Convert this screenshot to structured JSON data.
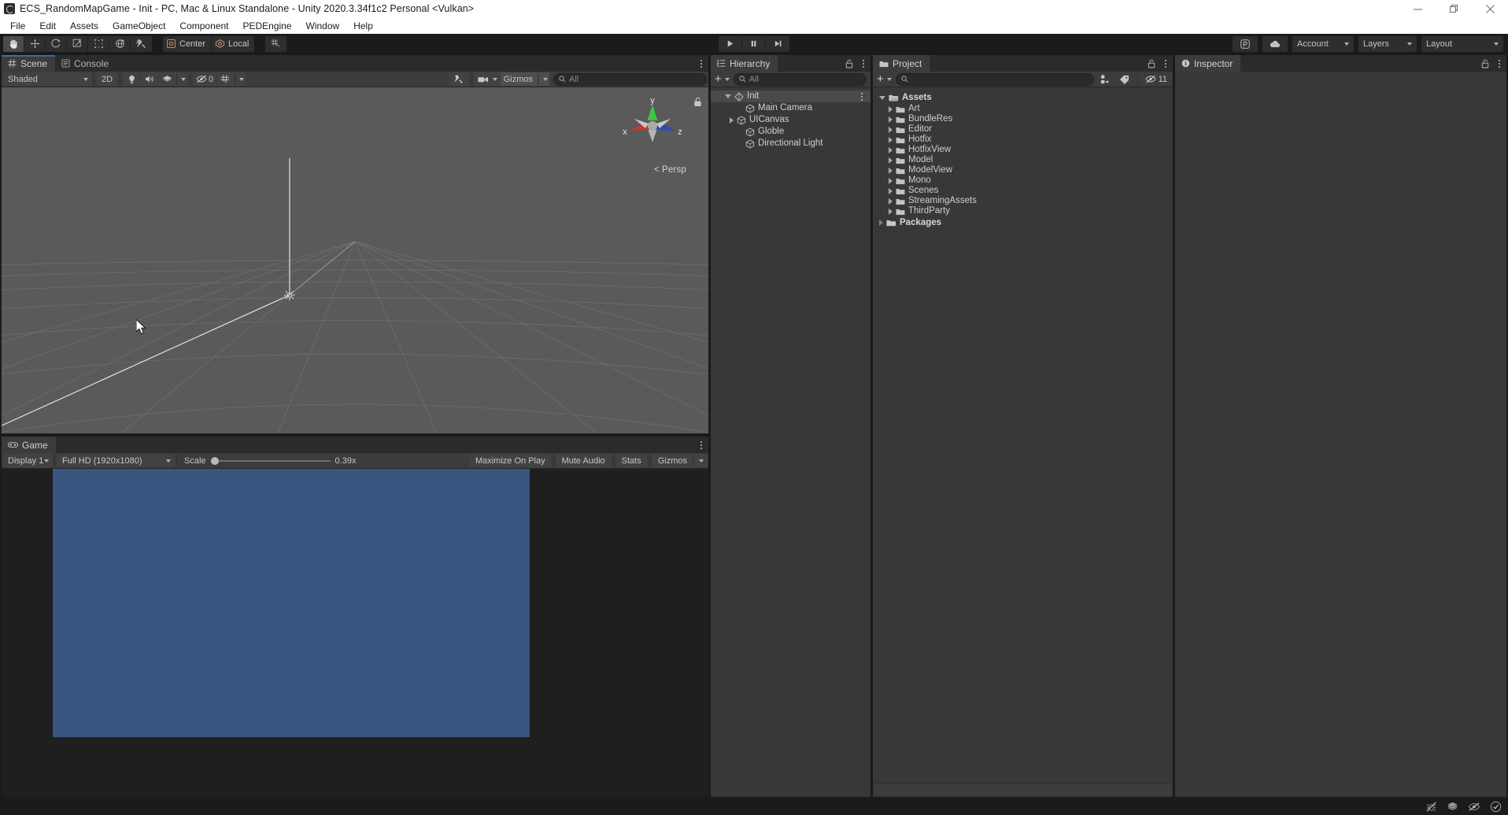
{
  "window": {
    "title": "ECS_RandomMapGame - Init - PC, Mac & Linux Standalone - Unity 2020.3.34f1c2 Personal <Vulkan>",
    "app_icon": "unity-icon",
    "minimize": "minimize-icon",
    "maximize": "restore-icon",
    "close": "close-icon"
  },
  "menubar": {
    "items": [
      {
        "label": "File"
      },
      {
        "label": "Edit"
      },
      {
        "label": "Assets"
      },
      {
        "label": "GameObject"
      },
      {
        "label": "Component"
      },
      {
        "label": "PEDEngine"
      },
      {
        "label": "Window"
      },
      {
        "label": "Help"
      }
    ]
  },
  "toolbar": {
    "tools": [
      {
        "name": "hand-tool",
        "icon": "hand-icon",
        "active": true
      },
      {
        "name": "move-tool",
        "icon": "move-icon",
        "active": false
      },
      {
        "name": "rotate-tool",
        "icon": "rotate-icon",
        "active": false
      },
      {
        "name": "scale-tool",
        "icon": "scale-icon",
        "active": false
      },
      {
        "name": "rect-tool",
        "icon": "rect-icon",
        "active": false
      },
      {
        "name": "transform-tool",
        "icon": "transform-icon",
        "active": false
      },
      {
        "name": "custom-tool",
        "icon": "wrench-icon",
        "active": false
      }
    ],
    "pivot_label": "Center",
    "pivot_icon": "pivot-center-icon",
    "handle_label": "Local",
    "handle_icon": "handle-local-icon",
    "grid_snap_icon": "grid-snap-icon",
    "play": "play-icon",
    "pause": "pause-icon",
    "step": "step-icon",
    "collab_icon": "collab-icon",
    "cloud_icon": "cloud-icon",
    "account_label": "Account",
    "layers_label": "Layers",
    "layout_label": "Layout"
  },
  "scene_panel": {
    "tabs": [
      {
        "label": "Scene",
        "icon": "scene-grid-icon",
        "active": true
      },
      {
        "label": "Console",
        "icon": "console-list-icon",
        "active": false
      }
    ],
    "lock_icon": "lock-open-icon",
    "menu_icon": "kebab-icon",
    "toolbar": {
      "draw_mode": "Shaded",
      "mode_2d": "2D",
      "lighting_icon": "light-bulb-icon",
      "audio_icon": "speaker-icon",
      "fx_icon": "fx-layers-icon",
      "hidden_count": "0",
      "hidden_icon": "eye-off-icon",
      "grid_icon": "scene-grid-visibility-icon",
      "tools_icon": "wrench-icon",
      "camera_icon": "camera-icon",
      "gizmos_label": "Gizmos",
      "search_placeholder": "All",
      "search_value": "",
      "search_icon": "search-icon"
    },
    "viewport": {
      "projection_label": "Persp",
      "axis_x": "x",
      "axis_y": "y",
      "axis_z": "z",
      "gizmo_lock_icon": "lock-open-icon",
      "cursor": "arrow-cursor",
      "background_color": "#5a5a5a",
      "grid_color": "#8e8e8e"
    }
  },
  "game_panel": {
    "tabs": [
      {
        "label": "Game",
        "icon": "game-controller-icon",
        "active": true
      }
    ],
    "menu_icon": "kebab-icon",
    "toolbar": {
      "display_label": "Display 1",
      "aspect_label": "Full HD (1920x1080)",
      "scale_label": "Scale",
      "scale_value": "0.39x",
      "maximize_label": "Maximize On Play",
      "mute_label": "Mute Audio",
      "stats_label": "Stats",
      "gizmos_label": "Gizmos"
    },
    "render_color": "#395580"
  },
  "hierarchy_panel": {
    "tabs": [
      {
        "label": "Hierarchy",
        "icon": "hierarchy-icon",
        "active": true
      }
    ],
    "lock_icon": "lock-open-icon",
    "menu_icon": "kebab-icon",
    "add_label": "+",
    "search_placeholder": "All",
    "search_value": "",
    "items": [
      {
        "label": "Init",
        "icon": "scene-asset-icon",
        "indent": 0,
        "twist": "open",
        "selected": true,
        "bold": false,
        "kebab": true
      },
      {
        "label": "Main Camera",
        "icon": "gameobject-icon",
        "indent": 1,
        "twist": "none",
        "selected": false,
        "bold": false,
        "kebab": false
      },
      {
        "label": "UICanvas",
        "icon": "gameobject-icon",
        "indent": 1,
        "twist": "closed",
        "selected": false,
        "bold": false,
        "kebab": false
      },
      {
        "label": "Globle",
        "icon": "gameobject-icon",
        "indent": 1,
        "twist": "none",
        "selected": false,
        "bold": false,
        "kebab": false
      },
      {
        "label": "Directional Light",
        "icon": "gameobject-icon",
        "indent": 1,
        "twist": "none",
        "selected": false,
        "bold": false,
        "kebab": false
      }
    ]
  },
  "project_panel": {
    "tabs": [
      {
        "label": "Project",
        "icon": "folder-icon",
        "active": true
      }
    ],
    "lock_icon": "lock-open-icon",
    "menu_icon": "kebab-icon",
    "add_label": "+",
    "search_placeholder": "",
    "search_value": "",
    "save_icon": "save-filter-icon",
    "label_icon": "tag-icon",
    "visibility_icon": "eye-off-icon",
    "visibility_count": "11",
    "items": [
      {
        "label": "Assets",
        "indent": 0,
        "twist": "open",
        "bold": true,
        "icon": "folder-open-icon"
      },
      {
        "label": "Art",
        "indent": 1,
        "twist": "closed",
        "bold": false,
        "icon": "folder-icon"
      },
      {
        "label": "BundleRes",
        "indent": 1,
        "twist": "closed",
        "bold": false,
        "icon": "folder-icon"
      },
      {
        "label": "Editor",
        "indent": 1,
        "twist": "closed",
        "bold": false,
        "icon": "folder-icon"
      },
      {
        "label": "Hotfix",
        "indent": 1,
        "twist": "closed",
        "bold": false,
        "icon": "folder-icon"
      },
      {
        "label": "HotfixView",
        "indent": 1,
        "twist": "closed",
        "bold": false,
        "icon": "folder-icon"
      },
      {
        "label": "Model",
        "indent": 1,
        "twist": "closed",
        "bold": false,
        "icon": "folder-icon"
      },
      {
        "label": "ModelView",
        "indent": 1,
        "twist": "closed",
        "bold": false,
        "icon": "folder-icon"
      },
      {
        "label": "Mono",
        "indent": 1,
        "twist": "closed",
        "bold": false,
        "icon": "folder-icon"
      },
      {
        "label": "Scenes",
        "indent": 1,
        "twist": "closed",
        "bold": false,
        "icon": "folder-icon"
      },
      {
        "label": "StreamingAssets",
        "indent": 1,
        "twist": "closed",
        "bold": false,
        "icon": "folder-icon"
      },
      {
        "label": "ThirdParty",
        "indent": 1,
        "twist": "closed",
        "bold": false,
        "icon": "folder-icon"
      },
      {
        "label": "Packages",
        "indent": 0,
        "twist": "closed",
        "bold": true,
        "icon": "folder-icon"
      }
    ]
  },
  "inspector_panel": {
    "tabs": [
      {
        "label": "Inspector",
        "icon": "info-icon",
        "active": true
      }
    ],
    "lock_icon": "lock-open-icon",
    "menu_icon": "kebab-icon"
  },
  "statusbar": {
    "icons": [
      {
        "name": "bug-off-icon"
      },
      {
        "name": "stack-icon"
      },
      {
        "name": "eye-off-icon"
      },
      {
        "name": "check-circle-icon"
      }
    ]
  },
  "colors": {
    "window_chrome": "#1b1b1b",
    "panel_bg": "#383838",
    "tab_active": "#3c3c3c",
    "tab_bar": "#2b2b2b",
    "accent_blue": "#3b6f9e",
    "text_primary": "#cfcfcf",
    "text_dim": "#8a8a8a",
    "scene_bg": "#5a5a5a",
    "game_render": "#395580"
  }
}
